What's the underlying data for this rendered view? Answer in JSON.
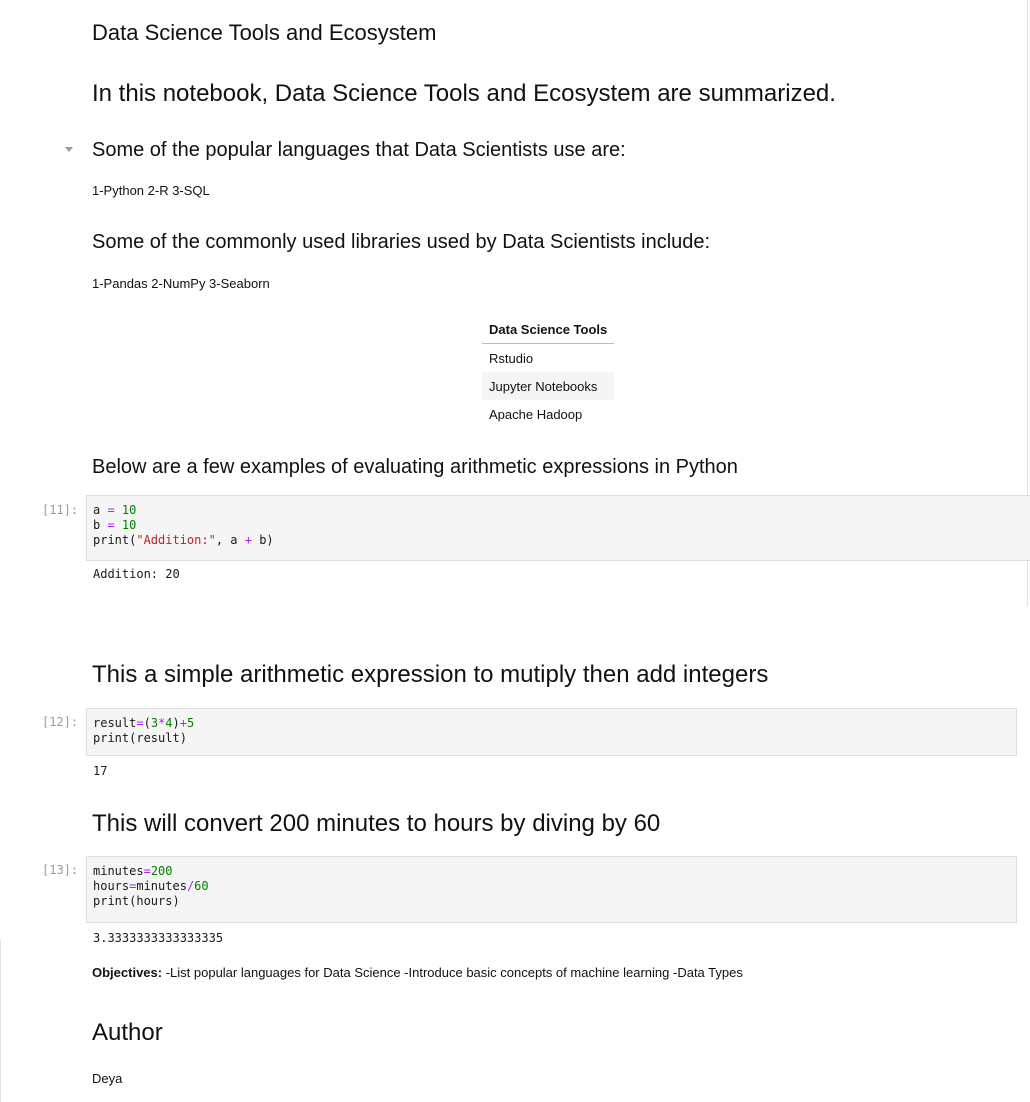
{
  "cells": {
    "title": "Data Science Tools and Ecosystem",
    "intro": "In this notebook, Data Science Tools and Ecosystem are summarized.",
    "languages_heading": "Some of the popular languages that Data Scientists use are:",
    "languages_text": "1-Python 2-R 3-SQL",
    "libraries_heading": "Some of the commonly used libraries used by Data Scientists include:",
    "libraries_text": "1-Pandas 2-NumPy 3-Seaborn",
    "tools_table": {
      "header": "Data Science Tools",
      "rows": [
        "Rstudio",
        "Jupyter Notebooks",
        "Apache Hadoop"
      ]
    },
    "arith_heading": "Below are a few examples of evaluating arithmetic expressions in Python",
    "multiply_heading": "This a simple arithmetic expression to mutiply then add integers",
    "convert_heading": "This will convert 200 minutes to hours by diving by 60",
    "objectives_label": "Objectives:",
    "objectives_text": " -List popular languages for Data Science -Introduce basic concepts of machine learning -Data Types",
    "author_heading": "Author",
    "author_name": "Deya"
  },
  "code_cells": [
    {
      "prompt": "[11]:",
      "lines": [
        [
          [
            "",
            "a "
          ],
          [
            "op",
            "="
          ],
          [
            "",
            " "
          ],
          [
            "num",
            "10"
          ]
        ],
        [
          [
            "",
            "b "
          ],
          [
            "op",
            "="
          ],
          [
            "",
            " "
          ],
          [
            "num",
            "10"
          ]
        ],
        [
          [
            "",
            "print("
          ],
          [
            "str",
            "\"Addition:\""
          ],
          [
            "",
            ", a "
          ],
          [
            "op",
            "+"
          ],
          [
            "",
            " b)"
          ]
        ]
      ],
      "output": "Addition: 20"
    },
    {
      "prompt": "[12]:",
      "lines": [
        [
          [
            "",
            "result"
          ],
          [
            "op",
            "="
          ],
          [
            "",
            "("
          ],
          [
            "num",
            "3"
          ],
          [
            "op",
            "*"
          ],
          [
            "num",
            "4"
          ],
          [
            "",
            ")"
          ],
          [
            "op",
            "+"
          ],
          [
            "num",
            "5"
          ]
        ],
        [
          [
            "",
            "print(result)"
          ]
        ]
      ],
      "output": "17"
    },
    {
      "prompt": "[13]:",
      "lines": [
        [
          [
            "",
            "minutes"
          ],
          [
            "op",
            "="
          ],
          [
            "num",
            "200"
          ]
        ],
        [
          [
            "",
            "hours"
          ],
          [
            "op",
            "="
          ],
          [
            "",
            "minutes"
          ],
          [
            "op",
            "/"
          ],
          [
            "num",
            "60"
          ]
        ],
        [
          [
            "",
            "print(hours)"
          ]
        ]
      ],
      "output": "3.3333333333333335"
    }
  ],
  "colors": {
    "number": "#008000",
    "operator": "#aa22ff",
    "string": "#ba2121",
    "prompt": "#9b9b9b",
    "code_bg": "#f5f5f5"
  }
}
